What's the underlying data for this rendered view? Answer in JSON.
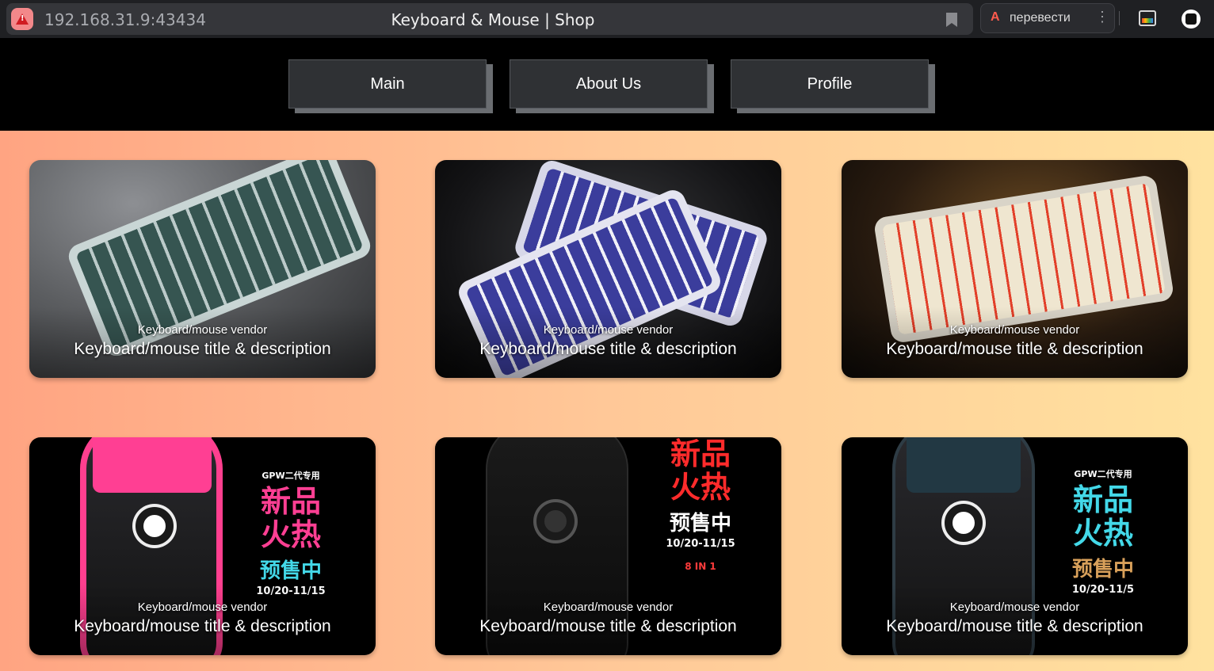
{
  "browser": {
    "address": "192.168.31.9:43434",
    "title": "Keyboard & Mouse | Shop",
    "translate_label": "перевести",
    "translate_icon": "A",
    "menu_glyph": "⋮"
  },
  "nav": {
    "items": [
      {
        "label": "Main"
      },
      {
        "label": "About Us"
      },
      {
        "label": "Profile"
      }
    ]
  },
  "cards": [
    {
      "vendor": "Keyboard/mouse vendor",
      "title": "Keyboard/mouse title & description"
    },
    {
      "vendor": "Keyboard/mouse vendor",
      "title": "Keyboard/mouse title & description"
    },
    {
      "vendor": "Keyboard/mouse vendor",
      "title": "Keyboard/mouse title & description"
    },
    {
      "vendor": "Keyboard/mouse vendor",
      "title": "Keyboard/mouse title & description",
      "promo": {
        "tag": "GPW二代专用",
        "line1": "新品",
        "line2": "火热",
        "presale": "预售中",
        "date": "10/20-11/15"
      }
    },
    {
      "vendor": "Keyboard/mouse vendor",
      "title": "Keyboard/mouse title & description",
      "promo": {
        "line1": "新品",
        "line2": "火热",
        "presale": "预售中",
        "date": "10/20-11/15",
        "extra": "8 IN 1"
      }
    },
    {
      "vendor": "Keyboard/mouse vendor",
      "title": "Keyboard/mouse title & description",
      "promo": {
        "tag": "GPW二代专用",
        "line1": "新品",
        "line2": "火热",
        "presale": "预售中",
        "date": "10/20-11/5"
      }
    }
  ],
  "colors": {
    "gradient_left": "#ffa482",
    "gradient_right": "#ffe29f",
    "nav_button": "#2f3134",
    "promo_pink": "#ff3f93",
    "promo_cyan": "#43d8e8",
    "promo_red": "#ff2b2b",
    "promo_gold": "#d8a05a"
  }
}
